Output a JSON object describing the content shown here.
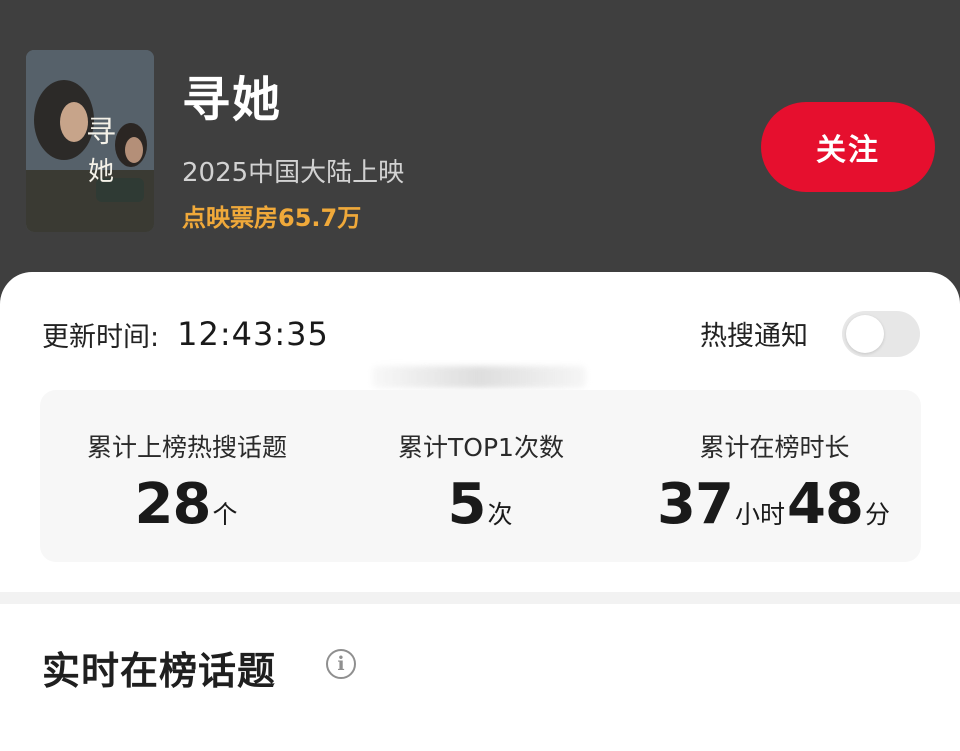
{
  "movie": {
    "title": "寻她",
    "release": "2025中国大陆上映",
    "box_office": "点映票房65.7万"
  },
  "follow_button": {
    "label": "关注"
  },
  "update": {
    "label": "更新时间:",
    "time": "12:43:35"
  },
  "notify": {
    "label": "热搜通知",
    "enabled": false
  },
  "stats": [
    {
      "label": "累计上榜热搜话题",
      "value": "28",
      "unit": "个"
    },
    {
      "label": "累计TOP1次数",
      "value": "5",
      "unit": "次"
    },
    {
      "label": "累计在榜时长",
      "hours": "37",
      "hours_unit": "小时",
      "minutes": "48",
      "minutes_unit": "分"
    }
  ],
  "section": {
    "title": "实时在榜话题",
    "info_icon": "info-icon"
  },
  "colors": {
    "header_bg": "#3f3f3f",
    "accent_red": "#e60f2e",
    "box_office_gold": "#f0a93a"
  }
}
